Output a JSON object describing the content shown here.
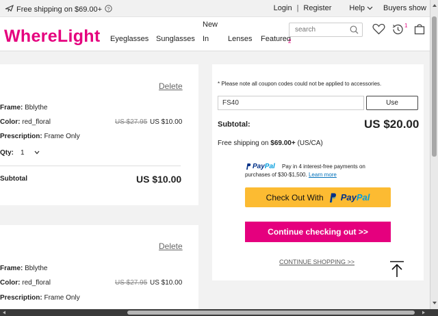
{
  "topbar": {
    "shipping_text": "Free shipping on $69.00+",
    "login": "Login",
    "separator": "|",
    "register": "Register",
    "help": "Help",
    "buyers_show": "Buyers show"
  },
  "header": {
    "logo": "WhereLight",
    "nav": {
      "eyeglasses": "Eyeglasses",
      "sunglasses": "Sunglasses",
      "new_line1": "New",
      "new_line2": "In",
      "lenses": "Lenses",
      "featured": "Featured",
      "featured_badge": "2"
    },
    "search_placeholder": "search",
    "history_badge": "1"
  },
  "cart_items": [
    {
      "delete": "Delete",
      "frame_label": "Frame:",
      "frame_value": "Bblythe",
      "color_label": "Color:",
      "color_value": "red_floral",
      "old_price": "US $27.95",
      "new_price": "US $10.00",
      "prescription_label": "Prescription:",
      "prescription_value": "Frame Only",
      "qty_label": "Qty:",
      "qty_value": "1",
      "subtotal_label": "Subtotal",
      "subtotal_value": "US $10.00"
    },
    {
      "delete": "Delete",
      "frame_label": "Frame:",
      "frame_value": "Bblythe",
      "color_label": "Color:",
      "color_value": "red_floral",
      "old_price": "US $27.95",
      "new_price": "US $10.00",
      "prescription_label": "Prescription:",
      "prescription_value": "Frame Only"
    }
  ],
  "summary": {
    "coupon_note": "* Please note all coupon codes could not be applied to accessories.",
    "coupon_value": "FS40",
    "use_button": "Use",
    "subtotal_label": "Subtotal:",
    "subtotal_value": "US $20.00",
    "free_ship_prefix": "Free shipping on ",
    "free_ship_amount": "$69.00+",
    "free_ship_suffix": " (US/CA)",
    "paypal_brand_pay": "Pay",
    "paypal_brand_pal": "Pal",
    "paypal_text": "Pay in 4 interest-free payments on",
    "paypal_text2": "purchases of $30-$1,500.",
    "learn_more": "Learn more",
    "checkout_with": "Check Out With",
    "continue_checkout": "Continue checking out >>",
    "continue_shopping": "CONTINUE SHOPPING >>"
  },
  "colors": {
    "brand": "#e5007e",
    "paypal_yellow": "#fcbb32",
    "paypal_dark_blue": "#003087",
    "paypal_light_blue": "#009cde"
  }
}
